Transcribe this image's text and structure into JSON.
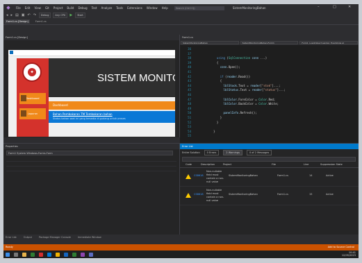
{
  "menu": {
    "items": [
      "File",
      "Edit",
      "View",
      "Git",
      "Project",
      "Build",
      "Debug",
      "Test",
      "Analyze",
      "Tools",
      "Extensions",
      "Window",
      "Help"
    ],
    "search_placeholder": "Search (Ctrl+Q)",
    "solution_title": "SistemMonitoringBahan"
  },
  "toolbar": {
    "config": "Debug",
    "platform": "Any CPU",
    "start_label": "Start"
  },
  "tabs": [
    "Form1.cs [Design]",
    "Form1.cs"
  ],
  "designer": {
    "header": "Form1.cs [Design]",
    "app_title": "SISTEM MONITORING",
    "side_buttons": [
      "Dashboard",
      "Laporan"
    ],
    "orange_label": "Dashboard",
    "blue_line1": "Bahan Pembakaran TM Tembakaran bahan",
    "blue_line2": "Status bahan saat ini yang tersedia di gudang untuk proses"
  },
  "properties": {
    "header": "Properties",
    "selected": "Form1 System.Windows.Forms.Form"
  },
  "editor": {
    "header": "Form1.cs",
    "dropdowns": [
      "SistemMonitoringBahan",
      "SistemMonitoringBahan.Form1",
      "Form1_Load(object sender, EventArgs e)"
    ],
    "line_numbers": [
      "36",
      "37",
      "38",
      "39",
      "40",
      "41",
      "42",
      "43",
      "44",
      "45",
      "46",
      "47",
      "48",
      "49",
      "50",
      "51",
      "52",
      "53",
      "54",
      "55"
    ]
  },
  "errorlist": {
    "header": "Error List",
    "scope": "Entire Solution",
    "errors": "0 Errors",
    "warnings": "2 Warnings",
    "messages": "0 of 2 Messages",
    "columns": [
      "Code",
      "Description",
      "Project",
      "File",
      "Line",
      "Suppression State"
    ],
    "rows": [
      {
        "code": "CS8618",
        "description": "Non-nullable field must contain a non-null value",
        "project": "SistemMonitoringBahan",
        "file": "Form1.cs",
        "line": "14",
        "suppression": "Active"
      },
      {
        "code": "CS8618",
        "description": "Non-nullable field must contain a non-null value",
        "project": "SistemMonitoringBahan",
        "file": "Form1.cs",
        "line": "15",
        "suppression": "Active"
      }
    ]
  },
  "footer_tabs": [
    "Error List",
    "Output",
    "Package Manager Console",
    "Immediate Window"
  ],
  "status": {
    "left": "Ready",
    "right": "Add to Source Control"
  },
  "taskbar": {
    "time": "10:41",
    "date": "12/05/2023"
  }
}
